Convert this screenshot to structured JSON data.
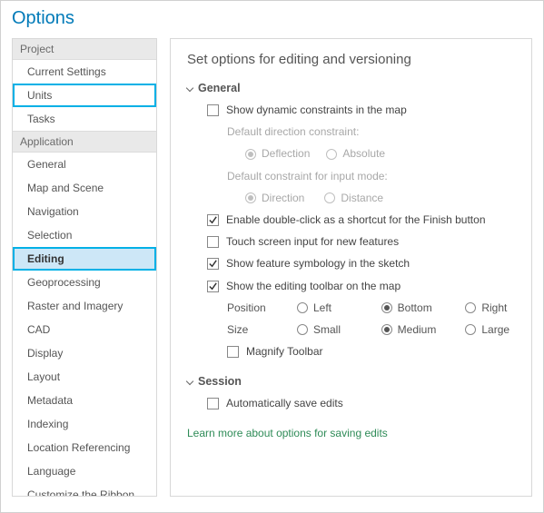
{
  "title": "Options",
  "sidebar": {
    "sections": [
      {
        "label": "Project",
        "items": [
          "Current Settings",
          "Units",
          "Tasks"
        ]
      },
      {
        "label": "Application",
        "items": [
          "General",
          "Map and Scene",
          "Navigation",
          "Selection",
          "Editing",
          "Geoprocessing",
          "Raster and Imagery",
          "CAD",
          "Display",
          "Layout",
          "Metadata",
          "Indexing",
          "Location Referencing",
          "Language",
          "Customize the Ribbon"
        ]
      }
    ]
  },
  "panel": {
    "heading": "Set options for editing and versioning",
    "general": {
      "label": "General",
      "show_dynamic": "Show dynamic constraints in the map",
      "default_dir_label": "Default direction constraint:",
      "deflection": "Deflection",
      "absolute": "Absolute",
      "default_input_label": "Default constraint for input mode:",
      "direction": "Direction",
      "distance": "Distance",
      "enable_dblclick": "Enable double-click as a shortcut for the Finish button",
      "touch": "Touch screen input for new features",
      "symbology": "Show feature symbology in the sketch",
      "toolbar": "Show the editing toolbar on the map",
      "position_label": "Position",
      "pos_left": "Left",
      "pos_bottom": "Bottom",
      "pos_right": "Right",
      "size_label": "Size",
      "size_small": "Small",
      "size_medium": "Medium",
      "size_large": "Large",
      "magnify": "Magnify Toolbar"
    },
    "session": {
      "label": "Session",
      "autosave": "Automatically save edits"
    },
    "link": "Learn more about options for saving edits"
  }
}
